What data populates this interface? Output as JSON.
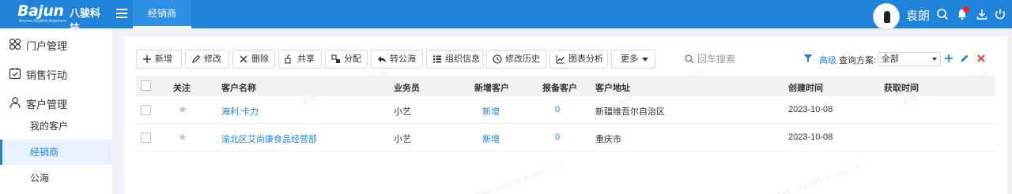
{
  "header": {
    "logo_text": "Bajun",
    "logo_cn": "八骏科技",
    "logo_tagline": "Anyone,Anytime,Anywhere",
    "active_tab": "经销商",
    "user_name": "袁朗",
    "brand_color": "#1f84d9"
  },
  "sidebar": {
    "groups": [
      {
        "label": "门户管理",
        "icon": "grid-icon"
      },
      {
        "label": "销售行动",
        "icon": "calendar-check-icon"
      },
      {
        "label": "客户管理",
        "icon": "user-icon"
      }
    ],
    "sub_items": [
      {
        "label": "我的客户"
      },
      {
        "label": "经销商",
        "active": true
      },
      {
        "label": "公海"
      }
    ]
  },
  "toolbar": {
    "buttons": [
      {
        "label": "新增",
        "icon": "plus-icon"
      },
      {
        "label": "修改",
        "icon": "pencil-icon"
      },
      {
        "label": "删除",
        "icon": "x-icon"
      },
      {
        "label": "共享",
        "icon": "share-icon"
      },
      {
        "label": "分配",
        "icon": "assign-icon"
      },
      {
        "label": "转公海",
        "icon": "return-icon"
      },
      {
        "label": "组织信息",
        "icon": "list-icon"
      },
      {
        "label": "修改历史",
        "icon": "clock-icon"
      },
      {
        "label": "图表分析",
        "icon": "chart-icon"
      }
    ],
    "more_label": "更多",
    "search_placeholder": "回车搜索",
    "advanced_label": "高级",
    "scheme_label": "查询方案:",
    "scheme_value": "全部"
  },
  "table": {
    "columns": [
      "关注",
      "客户名称",
      "业务员",
      "新增客户",
      "报备客户",
      "客户地址",
      "创建时间",
      "获取时间"
    ],
    "rows": [
      {
        "name": "海利.卡力",
        "salesperson": "小艺",
        "new_customer": "新增",
        "reported": "0",
        "address": "新疆维吾尔自治区",
        "created": "2023-10-08",
        "acquired": ""
      },
      {
        "name": "渝北区艾尚康食品经营部",
        "salesperson": "小艺",
        "new_customer": "新增",
        "reported": "0",
        "address": "重庆市",
        "created": "2023-10-08",
        "acquired": ""
      }
    ]
  },
  "watermark": "袁朗 八骏科技 2024-01-23"
}
